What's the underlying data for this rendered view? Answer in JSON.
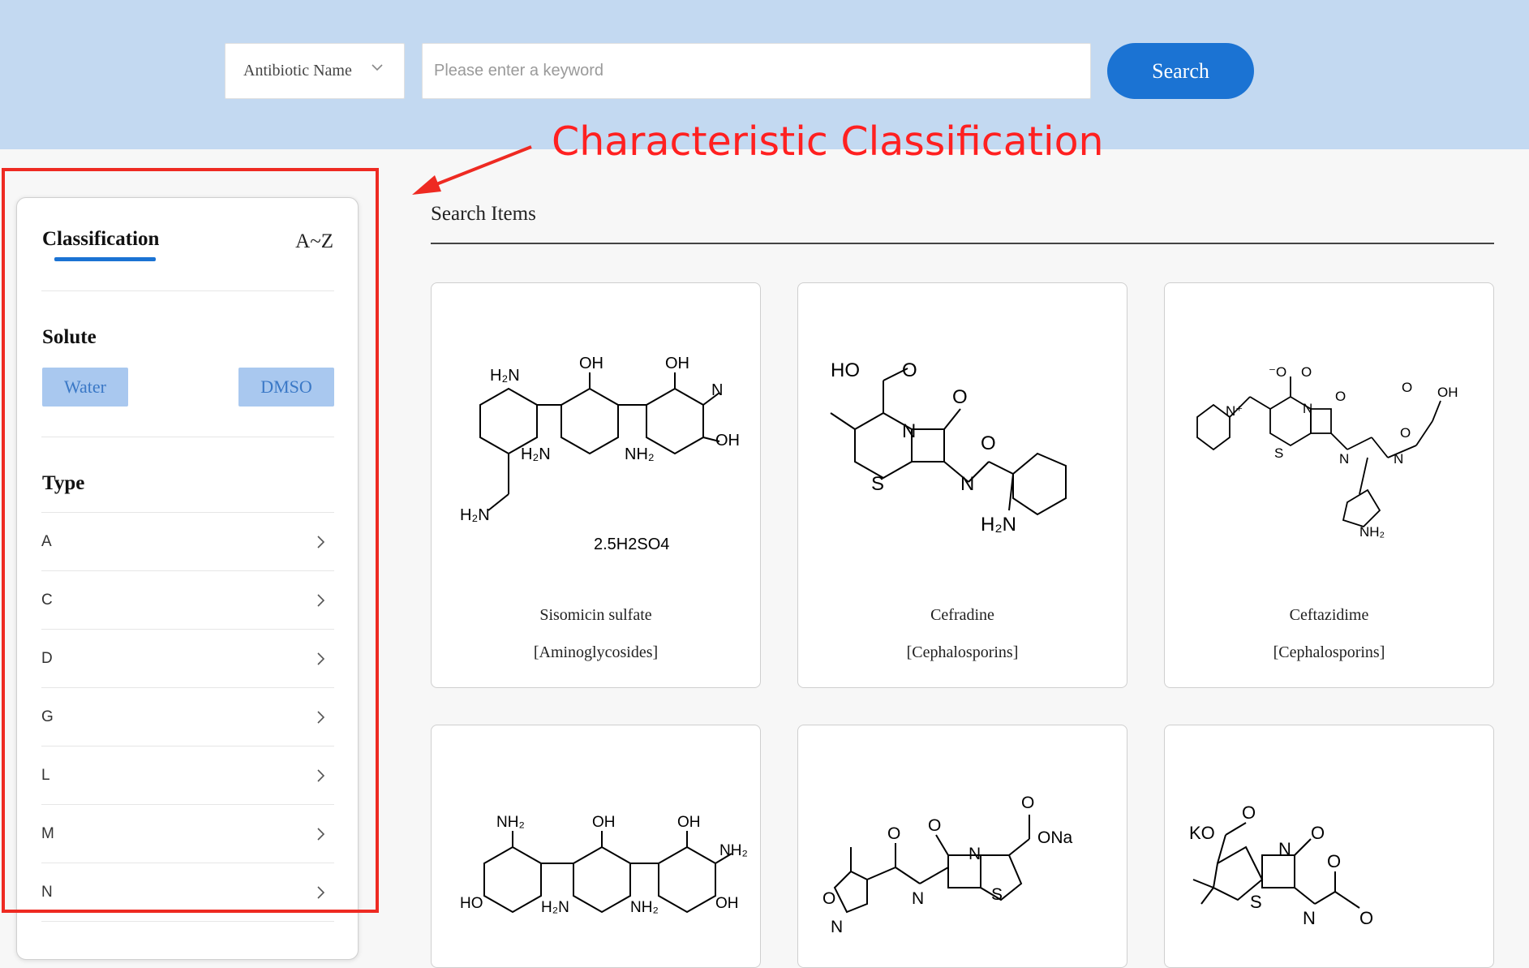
{
  "search": {
    "field_select": "Antibiotic Name",
    "keyword_placeholder": "Please enter a keyword",
    "button_label": "Search"
  },
  "annotation": {
    "label": "Characteristic Classification",
    "color": "#ee2a22"
  },
  "sidebar": {
    "tabs": [
      "Classification",
      "A~Z"
    ],
    "solute": {
      "title": "Solute",
      "options": [
        "Water",
        "DMSO"
      ]
    },
    "type": {
      "title": "Type",
      "items": [
        "A",
        "C",
        "D",
        "G",
        "L",
        "M",
        "N"
      ]
    }
  },
  "results": {
    "title": "Search Items",
    "items": [
      {
        "name": "Sisomicin sulfate",
        "class": "[Aminoglycosides]",
        "formula_note": "2.5H2SO4"
      },
      {
        "name": "Cefradine",
        "class": "[Cephalosporins]"
      },
      {
        "name": "Ceftazidime",
        "class": "[Cephalosporins]"
      },
      {
        "name": "",
        "class": ""
      },
      {
        "name": "",
        "class": ""
      },
      {
        "name": "",
        "class": ""
      }
    ]
  },
  "colors": {
    "header_bg": "#c3d9f1",
    "accent": "#1b73d3",
    "solute_btn_bg": "#a9c8ef"
  }
}
